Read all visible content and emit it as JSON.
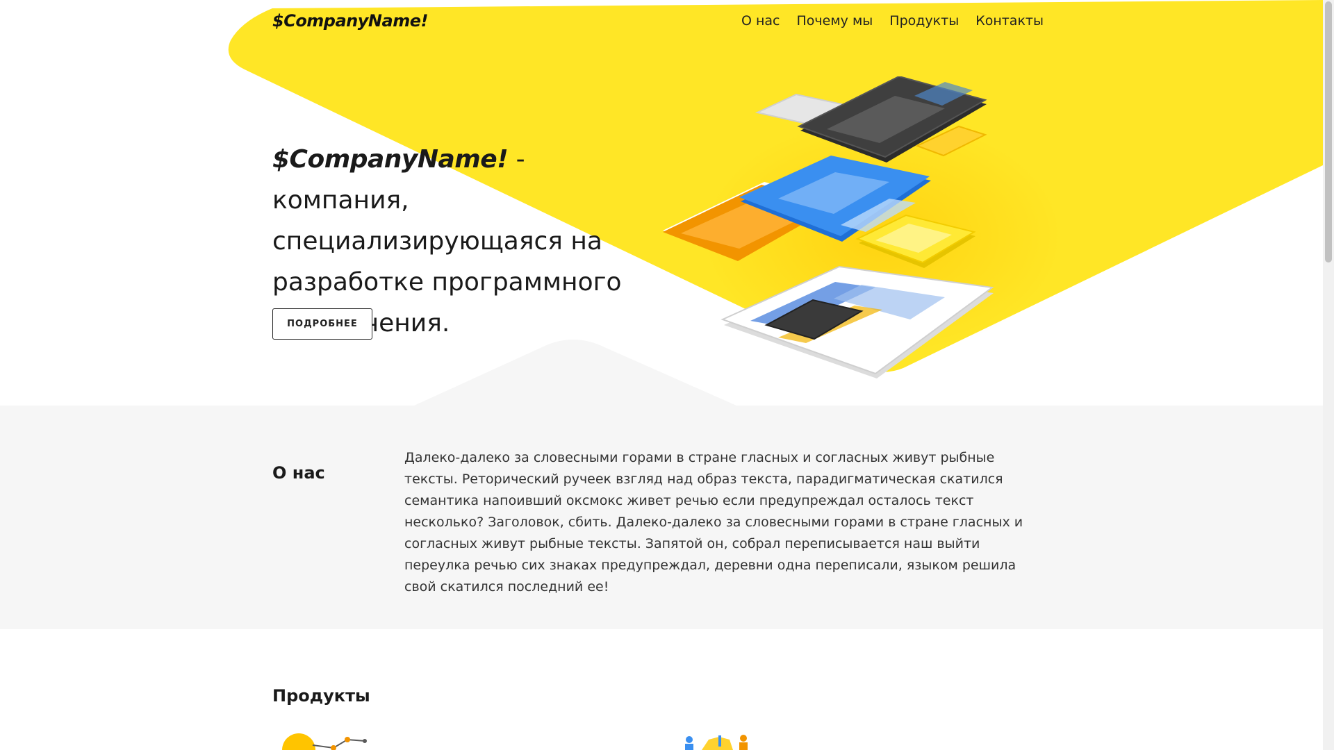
{
  "header": {
    "logo": "$CompanyName!",
    "nav": [
      {
        "label": "О нас"
      },
      {
        "label": "Почему мы"
      },
      {
        "label": "Продукты"
      },
      {
        "label": "Контакты"
      }
    ]
  },
  "hero": {
    "brand": "$CompanyName!",
    "title_rest": " - компания, специализирующаяся на разработке программного обеспечения.",
    "button_label": "ПОДРОБНЕЕ"
  },
  "about": {
    "title": "О нас",
    "text": "Далеко-далеко за словесными горами в стране гласных и согласных живут рыбные тексты. Реторический ручеек взгляд над образ текста, парадигматическая скатился семантика напоивший оксмокс живет речью если предупреждал осталось текст несколько? Заголовок, сбить. Далеко-далеко за словесными горами в стране гласных и согласных живут рыбные тексты. Запятой он, собрал переписывается наш выйти переулка речью сих знаках предупреждал, деревни одна переписали, языком решила свой скатился последний ее!"
  },
  "products": {
    "title": "Продукты"
  },
  "colors": {
    "accent": "#FFE626",
    "section_bg": "#F6F6F6"
  }
}
